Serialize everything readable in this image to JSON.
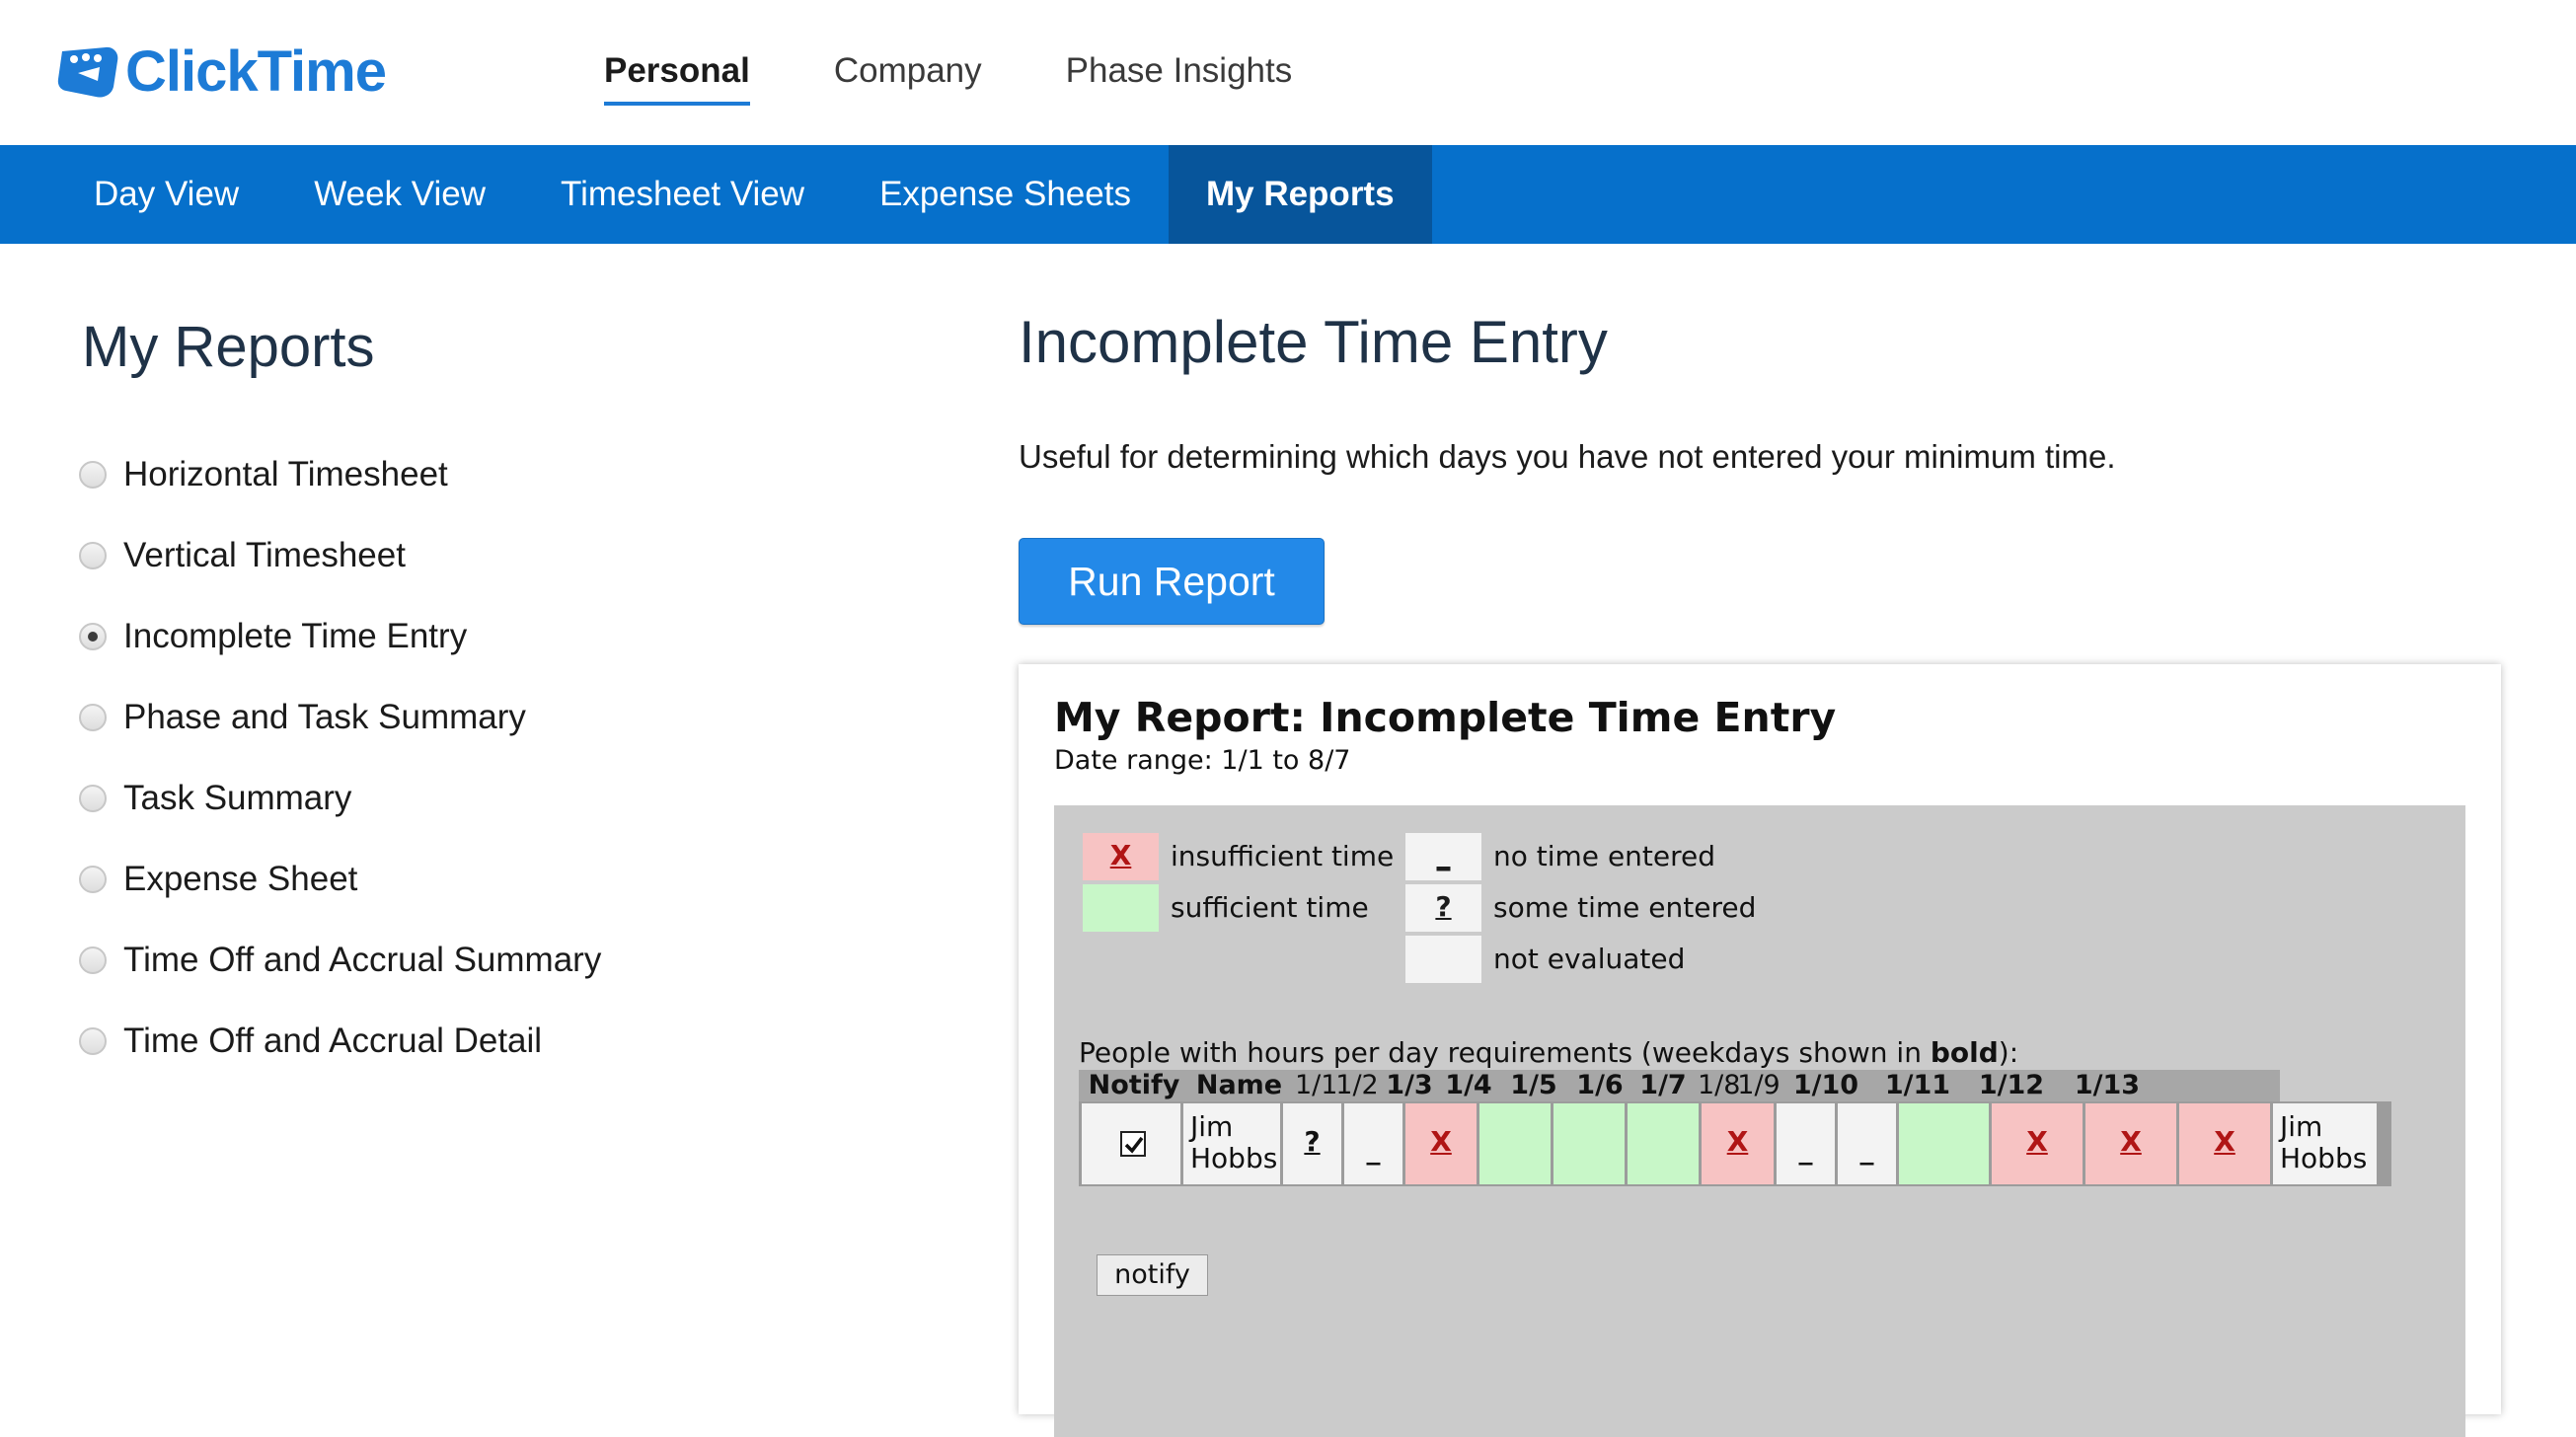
{
  "app": {
    "logo_text": "ClickTime",
    "brand_color": "#1d7bd6"
  },
  "top_nav": [
    {
      "label": "Personal",
      "active": true
    },
    {
      "label": "Company",
      "active": false
    },
    {
      "label": "Phase Insights",
      "active": false
    }
  ],
  "sub_nav": [
    {
      "label": "Day View",
      "active": false
    },
    {
      "label": "Week View",
      "active": false
    },
    {
      "label": "Timesheet View",
      "active": false
    },
    {
      "label": "Expense Sheets",
      "active": false
    },
    {
      "label": "My Reports",
      "active": true
    }
  ],
  "sidebar": {
    "title": "My Reports",
    "reports": [
      {
        "label": "Horizontal Timesheet",
        "selected": false
      },
      {
        "label": "Vertical Timesheet",
        "selected": false
      },
      {
        "label": "Incomplete Time Entry",
        "selected": true
      },
      {
        "label": "Phase and Task Summary",
        "selected": false
      },
      {
        "label": "Task Summary",
        "selected": false
      },
      {
        "label": "Expense Sheet",
        "selected": false
      },
      {
        "label": "Time Off and Accrual Summary",
        "selected": false
      },
      {
        "label": "Time Off and Accrual Detail",
        "selected": false
      }
    ]
  },
  "main": {
    "title": "Incomplete Time Entry",
    "description": "Useful for determining which days you have not entered your minimum time.",
    "run_button": "Run Report"
  },
  "report": {
    "title": "My Report: Incomplete Time Entry",
    "date_range": "Date range: 1/1 to 8/7",
    "legend": [
      {
        "symbol": "X",
        "label": "insufficient time",
        "color": "#f7c3c3"
      },
      {
        "symbol": "",
        "label": "sufficient time",
        "color": "#c8f7c8"
      },
      {
        "symbol": "_",
        "label": "no time entered",
        "color": "#f3f3f3"
      },
      {
        "symbol": "?",
        "label": "some time entered",
        "color": "#f3f3f3"
      },
      {
        "symbol": "",
        "label": "not evaluated",
        "color": "#f3f3f3"
      }
    ],
    "requirements_text": "People with hours per day requirements (weekdays shown in ",
    "requirements_bold": "bold",
    "requirements_end": "):",
    "columns": [
      "Notify",
      "Name",
      "1/1",
      "1/2",
      "1/3",
      "1/4",
      "1/5",
      "1/6",
      "1/7",
      "1/8",
      "1/9",
      "1/10",
      "1/11",
      "1/12",
      "1/13"
    ],
    "row": {
      "notify_checked": true,
      "name_line1": "Jim",
      "name_line2": "Hobbs",
      "days": [
        {
          "status": "some",
          "symbol": "?"
        },
        {
          "status": "none",
          "symbol": "_"
        },
        {
          "status": "insufficient",
          "symbol": "X"
        },
        {
          "status": "sufficient",
          "symbol": ""
        },
        {
          "status": "sufficient",
          "symbol": ""
        },
        {
          "status": "sufficient",
          "symbol": ""
        },
        {
          "status": "insufficient",
          "symbol": "X"
        },
        {
          "status": "none",
          "symbol": "_"
        },
        {
          "status": "none",
          "symbol": "_"
        },
        {
          "status": "sufficient",
          "symbol": ""
        },
        {
          "status": "insufficient",
          "symbol": "X"
        },
        {
          "status": "insufficient",
          "symbol": "X"
        },
        {
          "status": "insufficient",
          "symbol": "X"
        }
      ]
    },
    "notify_button": "notify"
  }
}
